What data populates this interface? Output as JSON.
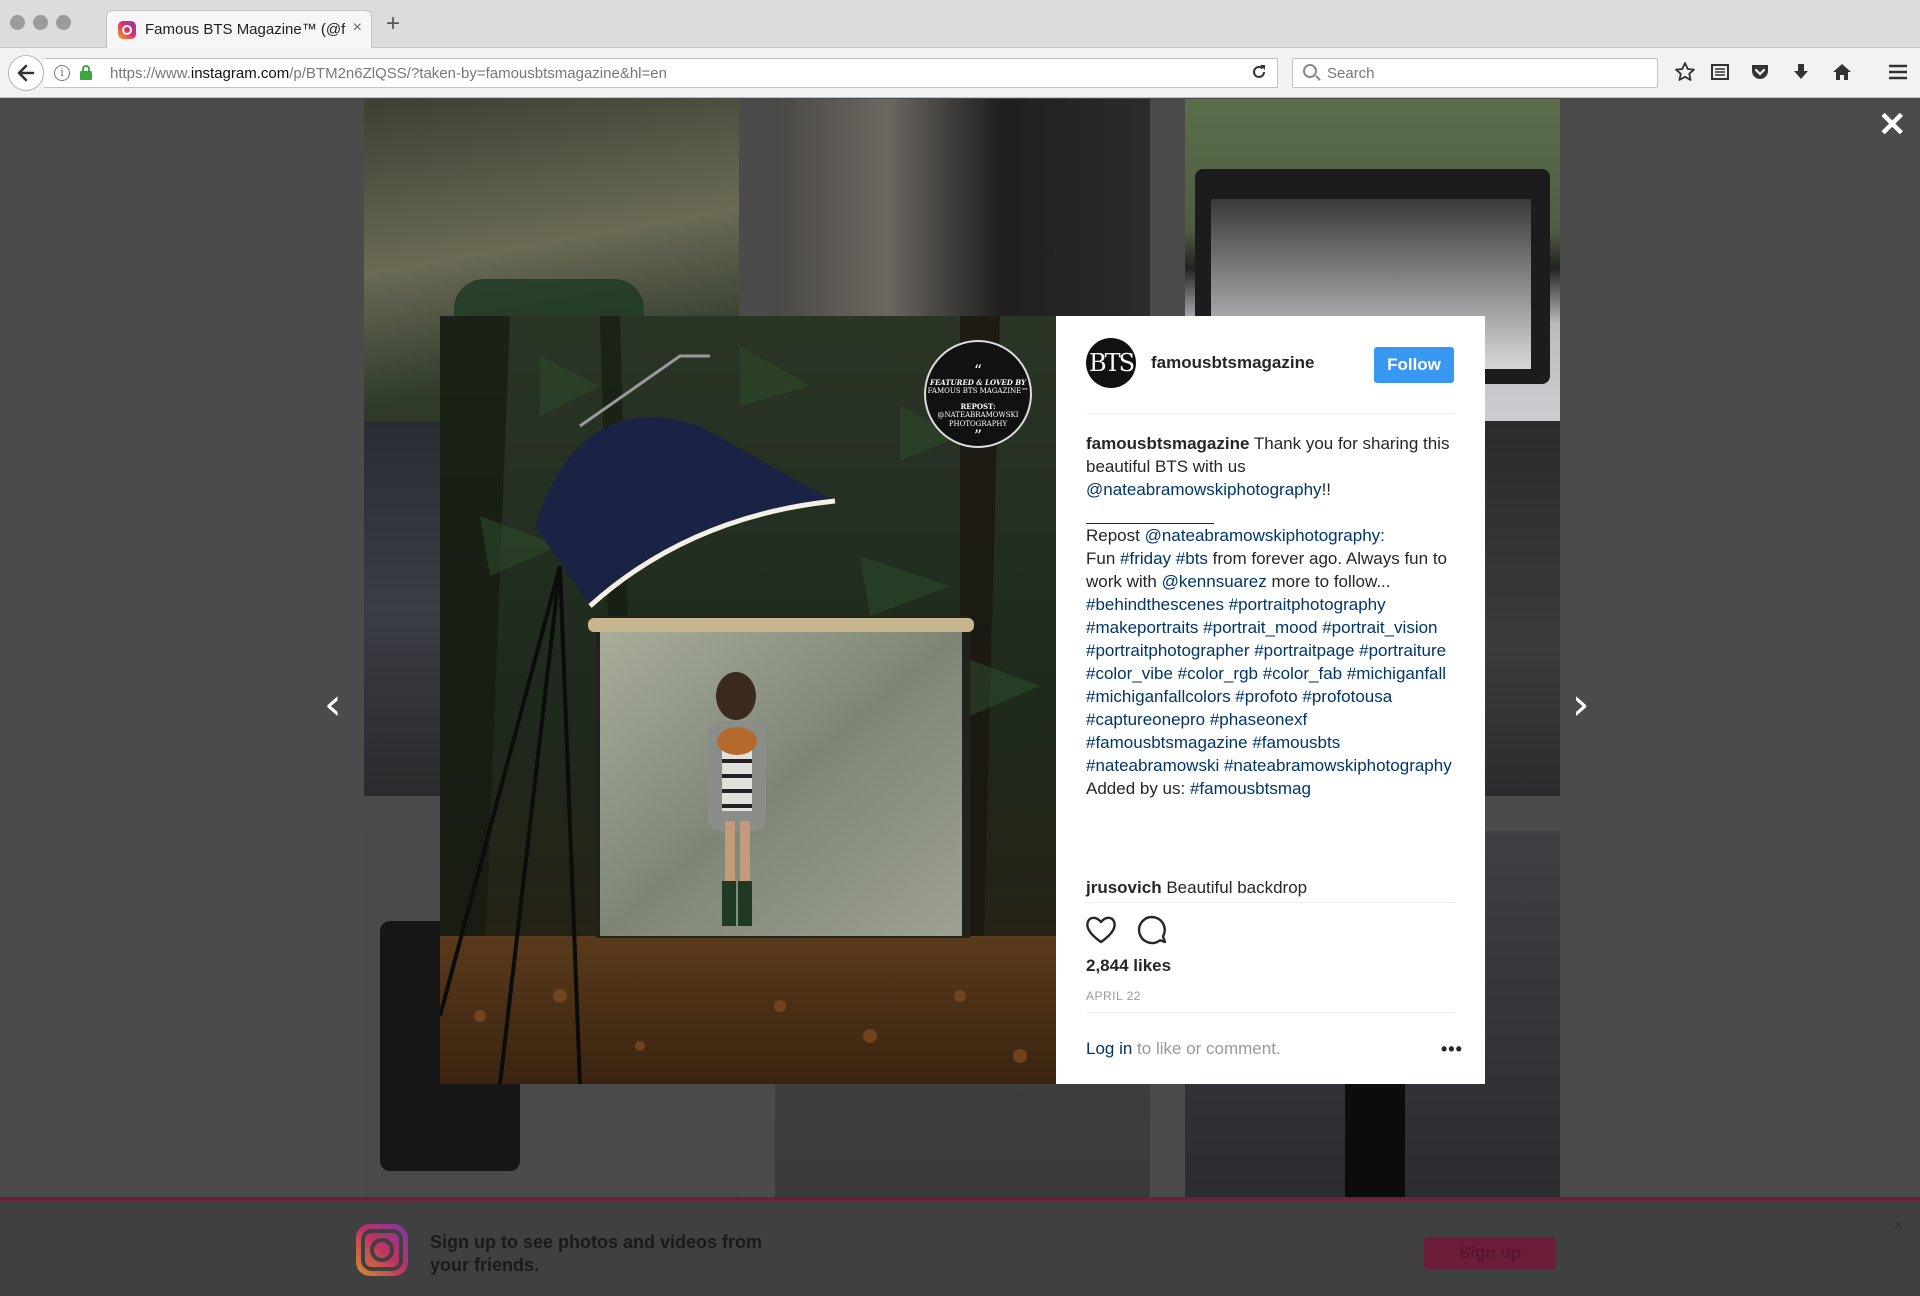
{
  "browser": {
    "tab_title": "Famous BTS Magazine™ (@f",
    "tab_close": "×",
    "new_tab": "+",
    "url_prefix": "https://www.",
    "url_host": "instagram.com",
    "url_path": "/p/BTM2n6ZlQSS/?taken-by=famousbtsmagazine&hl=en",
    "search_placeholder": "Search",
    "icons": [
      "back-icon",
      "info-icon",
      "lock-icon",
      "reload-icon",
      "search-icon",
      "bookmark-star-icon",
      "reading-list-icon",
      "pocket-icon",
      "download-icon",
      "home-icon",
      "menu-icon"
    ]
  },
  "overlay": {
    "close_glyph": "✕",
    "prev_glyph": "‹",
    "next_glyph": "›"
  },
  "post": {
    "badge_quote_open": "“",
    "badge_line1": "FEATURED & LOVED BY",
    "badge_line2": "FAMOUS BTS MAGAZINE™",
    "badge_line3": "REPOST:",
    "badge_line4": "@NATEABRAMOWSKI",
    "badge_line5": "PHOTOGRAPHY",
    "badge_quote_close": "”",
    "avatar_text": "BTS",
    "username": "famousbtsmagazine",
    "follow_label": "Follow",
    "caption": {
      "author": "famousbtsmagazine",
      "intro": " Thank you for sharing this beautiful BTS with us ",
      "mention1": "@nateabramowskiphotography",
      "intro_end": "!!",
      "repost_label": "Repost ",
      "mention2": "@nateabramowskiphotography",
      "colon": ":",
      "fun": "Fun ",
      "tag_friday": "#friday",
      "tag_bts": "#bts",
      "forever": " from forever ago. Always fun to work with ",
      "mention3": "@kennsuarez",
      "more": " more to follow... ",
      "hashtags": "#behindthescenes #portraitphotography #makeportraits #portrait_mood #portrait_vision #portraitphotographer #portraitpage #portraiture #color_vibe #color_rgb #color_fab #michiganfall #michiganfallcolors #profoto #profotousa #captureonepro #phaseonexf #famousbtsmagazine #famousbts #nateabramowski #nateabramowskiphotography",
      "added_by": "Added by us: ",
      "added_tag": "#famousbtsmag"
    },
    "comment_user": "jrusovich",
    "comment_text": " Beautiful backdrop",
    "likes": "2,844 likes",
    "date": "APRIL 22",
    "login_link": "Log in",
    "login_rest": " to like or comment.",
    "more_glyph": "•••"
  },
  "signup": {
    "text": "Sign up to see photos and videos from your friends.",
    "button": "Sign up",
    "close": "×"
  }
}
